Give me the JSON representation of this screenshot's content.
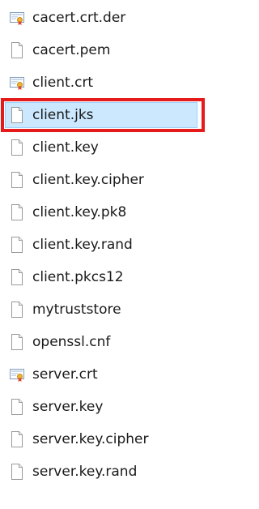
{
  "files": [
    {
      "name": "cacert.crt.der",
      "icon": "certificate-icon",
      "selected": false
    },
    {
      "name": "cacert.pem",
      "icon": "document-icon",
      "selected": false
    },
    {
      "name": "client.crt",
      "icon": "certificate-icon",
      "selected": false
    },
    {
      "name": "client.jks",
      "icon": "document-icon",
      "selected": true
    },
    {
      "name": "client.key",
      "icon": "document-icon",
      "selected": false
    },
    {
      "name": "client.key.cipher",
      "icon": "document-icon",
      "selected": false
    },
    {
      "name": "client.key.pk8",
      "icon": "document-icon",
      "selected": false
    },
    {
      "name": "client.key.rand",
      "icon": "document-icon",
      "selected": false
    },
    {
      "name": "client.pkcs12",
      "icon": "document-icon",
      "selected": false
    },
    {
      "name": "mytruststore",
      "icon": "document-icon",
      "selected": false
    },
    {
      "name": "openssl.cnf",
      "icon": "document-icon",
      "selected": false
    },
    {
      "name": "server.crt",
      "icon": "certificate-icon",
      "selected": false
    },
    {
      "name": "server.key",
      "icon": "document-icon",
      "selected": false
    },
    {
      "name": "server.key.cipher",
      "icon": "document-icon",
      "selected": false
    },
    {
      "name": "server.key.rand",
      "icon": "document-icon",
      "selected": false
    }
  ],
  "colors": {
    "selection_fill": "#cce8ff",
    "selection_border": "#99d1ff",
    "annotation": "#e51a1a",
    "text": "#1a1a1a"
  }
}
